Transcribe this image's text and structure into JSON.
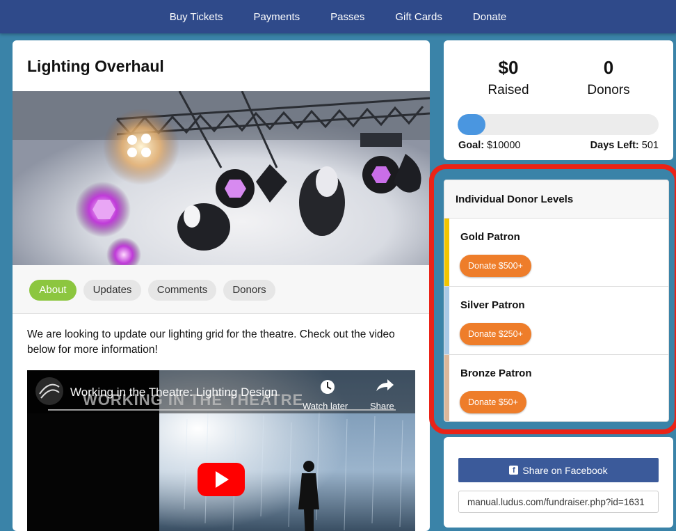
{
  "nav": {
    "items": [
      "Buy Tickets",
      "Payments",
      "Passes",
      "Gift Cards",
      "Donate"
    ]
  },
  "campaign": {
    "title": "Lighting Overhaul",
    "tabs": [
      "About",
      "Updates",
      "Comments",
      "Donors"
    ],
    "active_tab": "About",
    "description": "We are looking to update our lighting grid for the theatre. Check out the video below for more information!"
  },
  "video": {
    "title": "Working in the Theatre: Lighting Design",
    "banner": "WORKING IN THE THEATRE",
    "watch_later": "Watch later",
    "share": "Share"
  },
  "stats": {
    "raised_value": "$0",
    "raised_label": "Raised",
    "donors_value": "0",
    "donors_label": "Donors",
    "goal_label": "Goal:",
    "goal_value": "$10000",
    "days_label": "Days Left:",
    "days_value": "501",
    "progress_fraction": 0.0
  },
  "donor_levels": {
    "heading": "Individual Donor Levels",
    "levels": [
      {
        "name": "Gold Patron",
        "button": "Donate $500+",
        "color": "#f2c500"
      },
      {
        "name": "Silver Patron",
        "button": "Donate $250+",
        "color": "#a9c9e6"
      },
      {
        "name": "Bronze Patron",
        "button": "Donate $50+",
        "color": "#dcb79a"
      }
    ]
  },
  "share": {
    "facebook_label": "Share on Facebook",
    "url": "manual.ludus.com/fundraiser.php?id=1631"
  },
  "colors": {
    "nav_bg": "#2f4a8a",
    "page_bg": "#3a83a8",
    "active_tab": "#8cc63f",
    "donate_button": "#ee7d2a",
    "progress": "#4a96e0",
    "facebook": "#3b5a9a",
    "highlight": "#ea2317"
  }
}
